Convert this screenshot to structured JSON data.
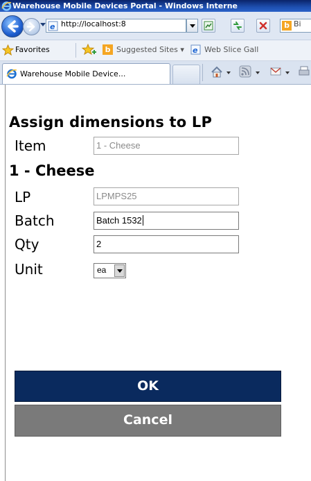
{
  "browser": {
    "window_title": "Warehouse Mobile Devices Portal - Windows Interne",
    "address_url": "http://localhost:8",
    "search_partial": "Bi",
    "favorites_label": "Favorites",
    "favorites_links": [
      {
        "label": "Suggested Sites ▾",
        "icon": "bing-icon"
      },
      {
        "label": "Web Slice Gall",
        "icon": "ie-page-icon"
      }
    ],
    "tab_label": "Warehouse Mobile Device...",
    "colors": {
      "titlebar": "#0a246a",
      "chrome": "#dfe7f3"
    }
  },
  "form": {
    "title": "Assign dimensions to LP",
    "item": {
      "label": "Item",
      "value": "1 - Cheese",
      "disabled": true
    },
    "item_name": "1 - Cheese",
    "lp": {
      "label": "LP",
      "value": "LPMPS25",
      "disabled": true
    },
    "batch": {
      "label": "Batch",
      "value": "Batch 1532"
    },
    "qty": {
      "label": "Qty",
      "value": "2"
    },
    "unit": {
      "label": "Unit",
      "selected": "ea"
    },
    "ok_label": "OK",
    "cancel_label": "Cancel",
    "colors": {
      "ok_bg": "#0a2a5e",
      "cancel_bg": "#7a7a7a"
    }
  }
}
